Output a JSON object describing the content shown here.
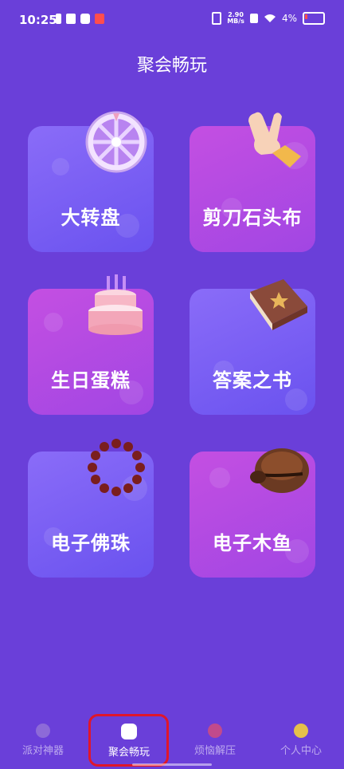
{
  "status_bar": {
    "time": "10:25",
    "net_speed_value": "2.90",
    "net_speed_unit": "MB/s",
    "battery": "4%"
  },
  "page": {
    "title": "聚会畅玩"
  },
  "cards": [
    {
      "label": "大转盘",
      "icon": "wheel-icon"
    },
    {
      "label": "剪刀石头布",
      "icon": "victory-hand-icon"
    },
    {
      "label": "生日蛋糕",
      "icon": "birthday-cake-icon"
    },
    {
      "label": "答案之书",
      "icon": "book-icon"
    },
    {
      "label": "电子佛珠",
      "icon": "prayer-beads-icon"
    },
    {
      "label": "电子木鱼",
      "icon": "wooden-fish-icon"
    }
  ],
  "nav": {
    "items": [
      {
        "label": "派对神器",
        "icon": "party-icon"
      },
      {
        "label": "聚会畅玩",
        "icon": "gamepad-icon",
        "active": true
      },
      {
        "label": "烦恼解压",
        "icon": "heart-icon"
      },
      {
        "label": "个人中心",
        "icon": "smile-icon"
      }
    ]
  }
}
